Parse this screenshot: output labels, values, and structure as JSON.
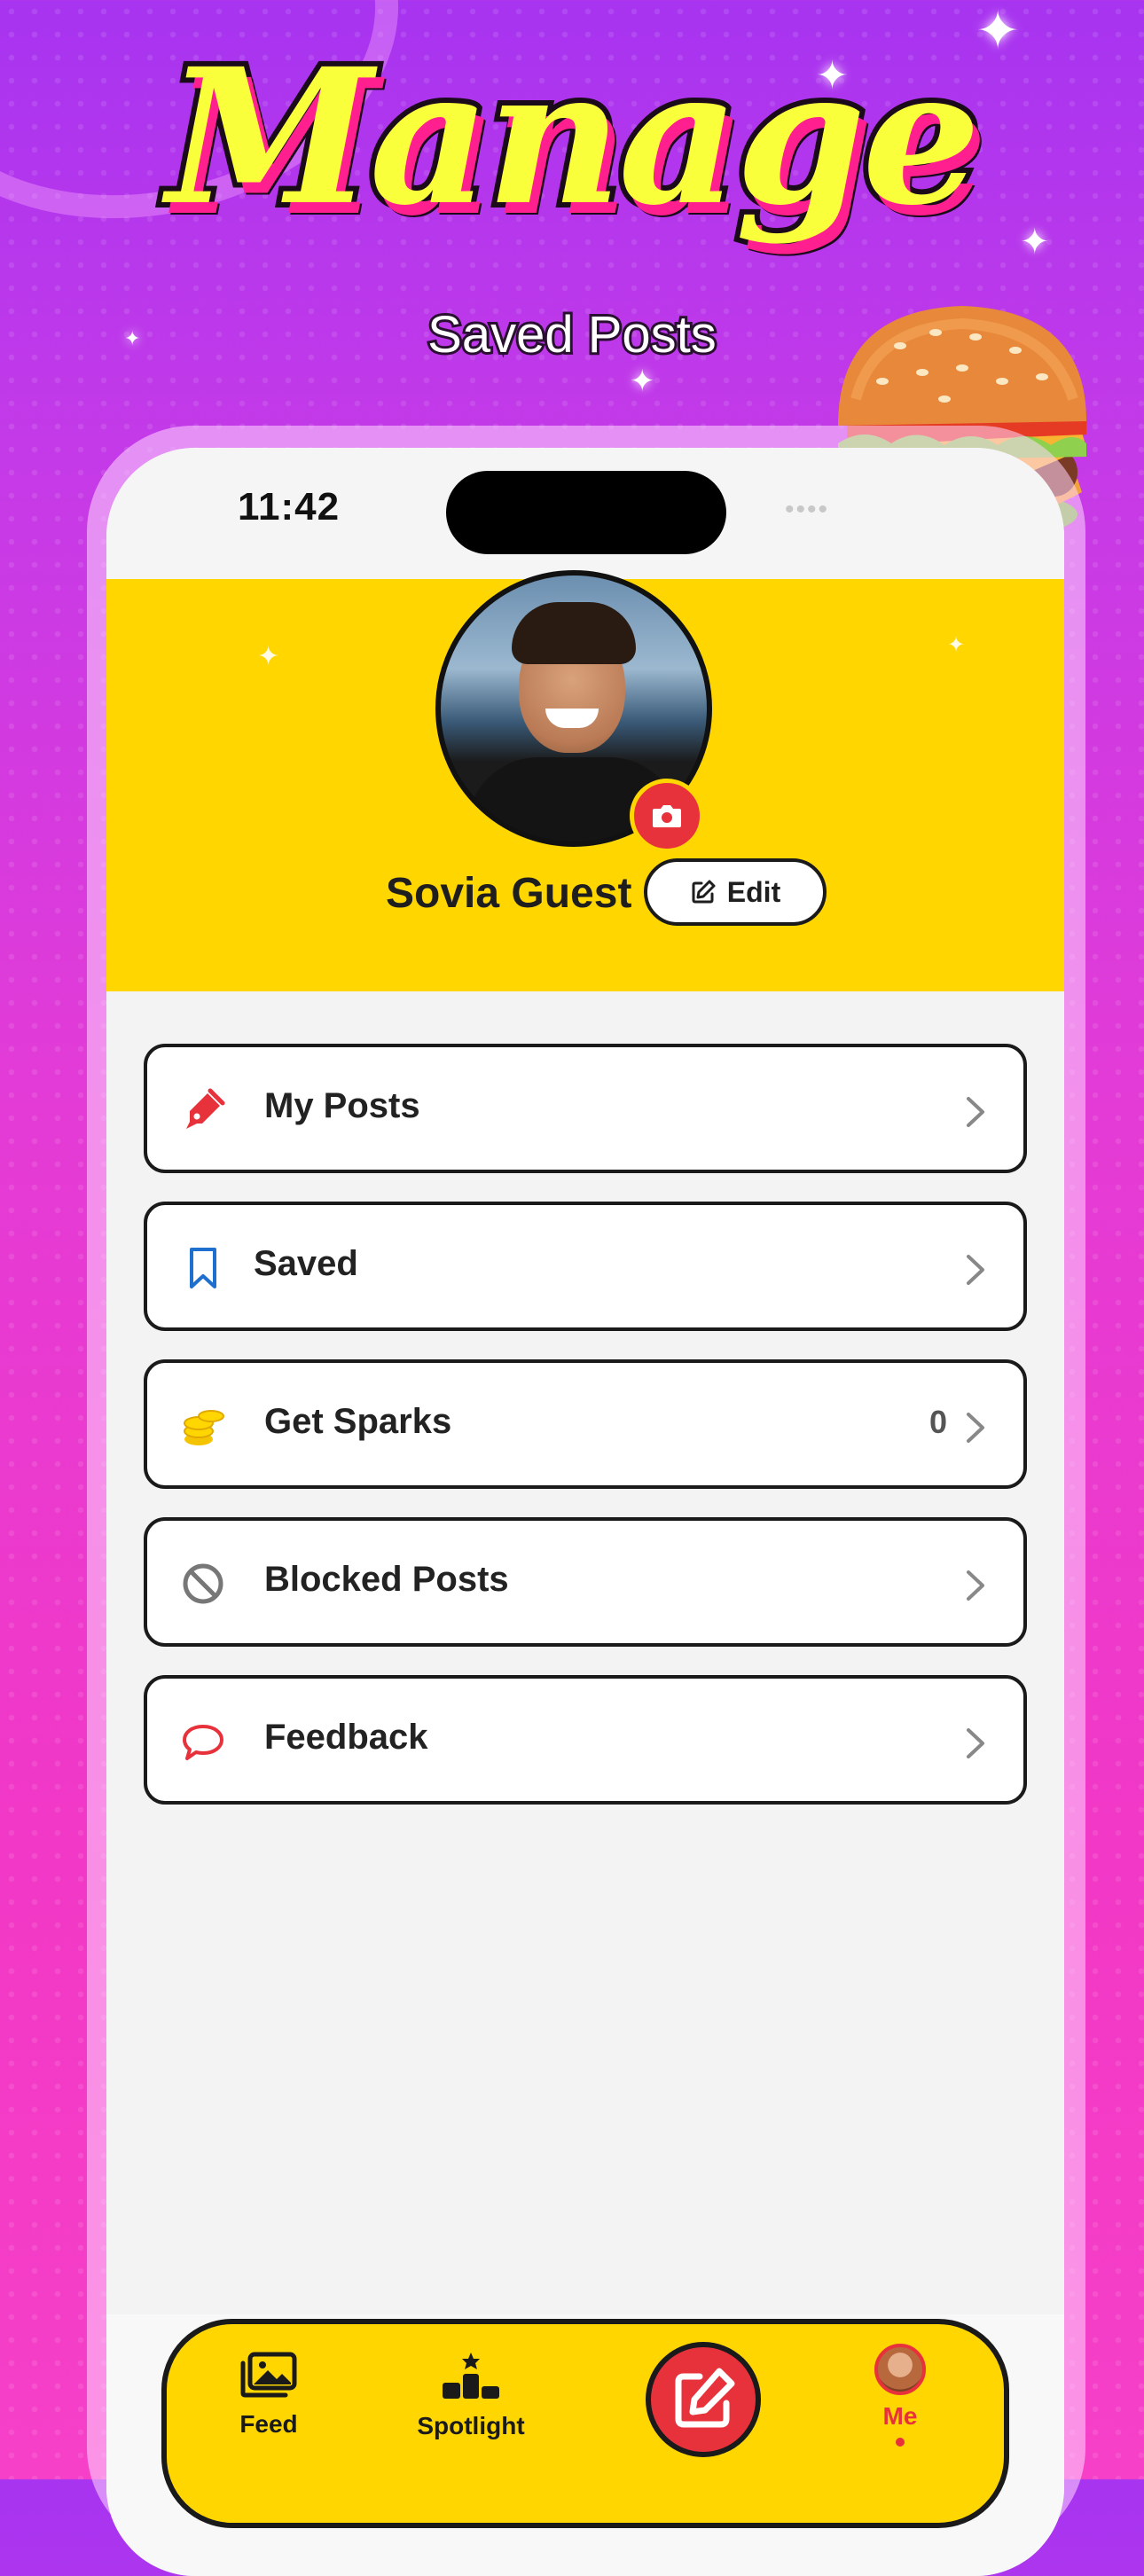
{
  "promo": {
    "headline": "Manage",
    "subheadline": "Saved Posts"
  },
  "status_bar": {
    "time": "11:42"
  },
  "profile": {
    "name": "Sovia Guest",
    "edit_label": "Edit"
  },
  "menu": [
    {
      "label": "My Posts",
      "icon": "pen-icon",
      "count": ""
    },
    {
      "label": "Saved",
      "icon": "bookmark-icon",
      "count": ""
    },
    {
      "label": "Get Sparks",
      "icon": "coins-icon",
      "count": "0"
    },
    {
      "label": "Blocked Posts",
      "icon": "block-icon",
      "count": ""
    },
    {
      "label": "Feedback",
      "icon": "chat-bubble-icon",
      "count": ""
    }
  ],
  "tab_bar": {
    "feed": "Feed",
    "spotlight": "Spotlight",
    "me": "Me",
    "active": "me"
  },
  "colors": {
    "accent_yellow": "#ffd600",
    "accent_red": "#e8323b",
    "headline_yellow": "#f9ff3b",
    "background_magenta": "#e43bd6"
  }
}
